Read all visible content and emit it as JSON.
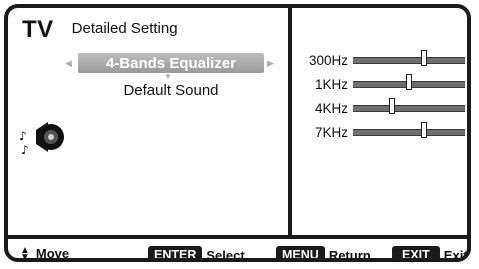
{
  "header": {
    "source": "TV",
    "menu_title": "Detailed Setting"
  },
  "options": [
    {
      "label": "4-Bands Equalizer",
      "selected": true
    },
    {
      "label": "Default Sound",
      "selected": false
    }
  ],
  "equalizer": {
    "bands": [
      {
        "label": "300Hz",
        "level": 0.63
      },
      {
        "label": "1KHz",
        "level": 0.5
      },
      {
        "label": "4KHz",
        "level": 0.35
      },
      {
        "label": "7KHz",
        "level": 0.63
      }
    ]
  },
  "footer": {
    "move": "Move",
    "enter_key": "ENTER",
    "enter_label": "Select",
    "menu_key": "MENU",
    "menu_label": "Return",
    "exit_key": "EXIT",
    "exit_label": "Exit"
  },
  "icons": {
    "sound": "speaker-music-icon",
    "move": "up-down-arrows-icon"
  },
  "colors": {
    "frame": "#1a1a1a",
    "highlight": "#aaaaaa",
    "track": "#6f6f6f"
  }
}
